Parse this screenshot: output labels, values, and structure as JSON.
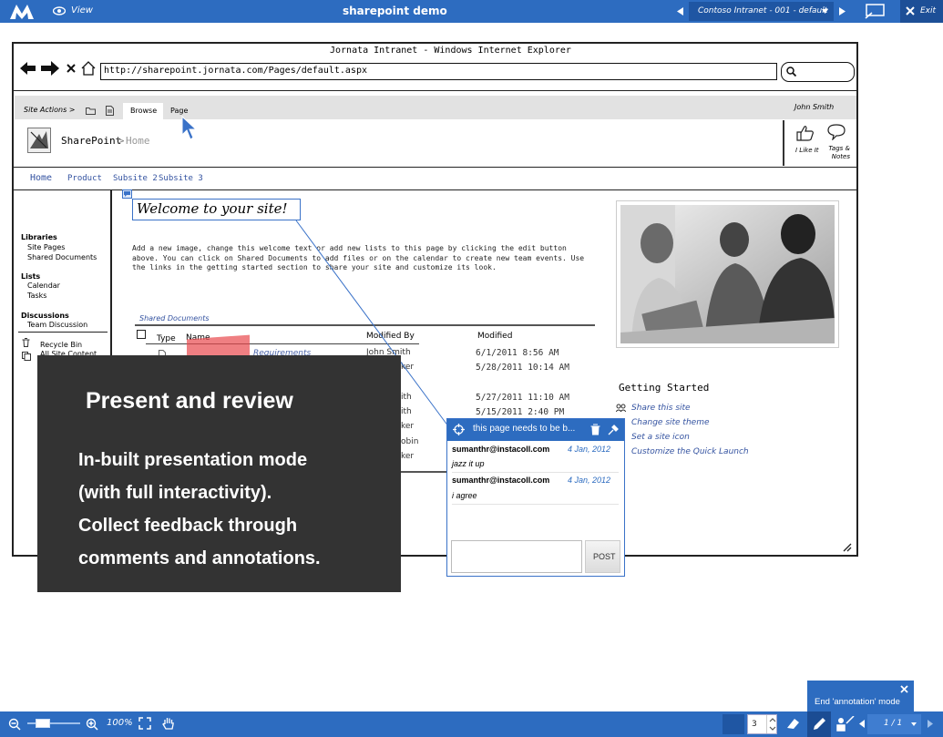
{
  "topbar": {
    "view_label": "View",
    "title": "sharepoint demo",
    "page_selector": "Contoso Intranet - 001 - default",
    "exit_label": "Exit"
  },
  "browser": {
    "title": "Jornata Intranet - Windows Internet Explorer",
    "url": "http://sharepoint.jornata.com/Pages/default.aspx"
  },
  "sharepoint": {
    "ribbon": {
      "site_actions": "Site Actions >",
      "tab_browse": "Browse",
      "tab_page": "Page",
      "user": "John Smith"
    },
    "brand": {
      "name": "SharePoint",
      "separator": ">",
      "crumb": "Home"
    },
    "social": {
      "like": "I Like It",
      "tags": "Tags & Notes"
    },
    "nav": [
      "Home",
      "Product",
      "Subsite 2",
      "Subsite 3"
    ],
    "quicklaunch": {
      "libraries_heading": "Libraries",
      "libraries": [
        "Site Pages",
        "Shared Documents"
      ],
      "lists_heading": "Lists",
      "lists": [
        "Calendar",
        "Tasks"
      ],
      "discussions_heading": "Discussions",
      "discussions": [
        "Team Discussion"
      ],
      "recycle": "Recycle Bin",
      "all_content": "All Site Content"
    },
    "welcome_title": "Welcome to your site!",
    "welcome_text": "Add a new image, change this welcome text or add new lists to this page by clicking the edit button above. You can click on Shared Documents to add files or on the calendar to create new team events. Use the links in the getting started section to share your site and customize its look.",
    "docs": {
      "title": "Shared Documents",
      "columns": {
        "type": "Type",
        "name": "Name",
        "modified_by": "Modified By",
        "modified": "Modified"
      },
      "row_texts": {
        "r1_name": "Requirements",
        "r1_by": "John Smith",
        "r1_date": "6/1/2011 8:56 AM",
        "r2_by": "ker",
        "r2_date": "5/28/2011 10:14 AM",
        "r3_by": "ith",
        "r3_date": "5/27/2011 11:10 AM",
        "r4_by": "ith",
        "r4_date": "5/15/2011 2:40 PM",
        "r5_by": "ker",
        "r6_by": "obin",
        "r7_by": "ker"
      }
    },
    "getting_started": {
      "heading": "Getting Started",
      "links": [
        "Share this site",
        "Change site theme",
        "Set a site icon",
        "Customize the Quick Launch"
      ]
    }
  },
  "overlay": {
    "heading": "Present and review",
    "lines": [
      "In-built presentation mode",
      "(with full interactivity).",
      "Collect feedback through",
      "comments and annotations."
    ]
  },
  "comment": {
    "title": "this page needs to be b...",
    "entries": [
      {
        "user": "sumanthr@instacoll.com",
        "date": "4 Jan, 2012",
        "text": "jazz it up"
      },
      {
        "user": "sumanthr@instacoll.com",
        "date": "4 Jan, 2012",
        "text": "i agree"
      }
    ],
    "post_label": "POST"
  },
  "annotation": {
    "end_label": "End 'annotation' mode"
  },
  "bottombar": {
    "zoom": "100%",
    "page_number": "3",
    "page_count": "1 / 1"
  },
  "colors": {
    "accent": "#2d6cc0",
    "overlay": "#333333",
    "link": "#3352a0"
  }
}
